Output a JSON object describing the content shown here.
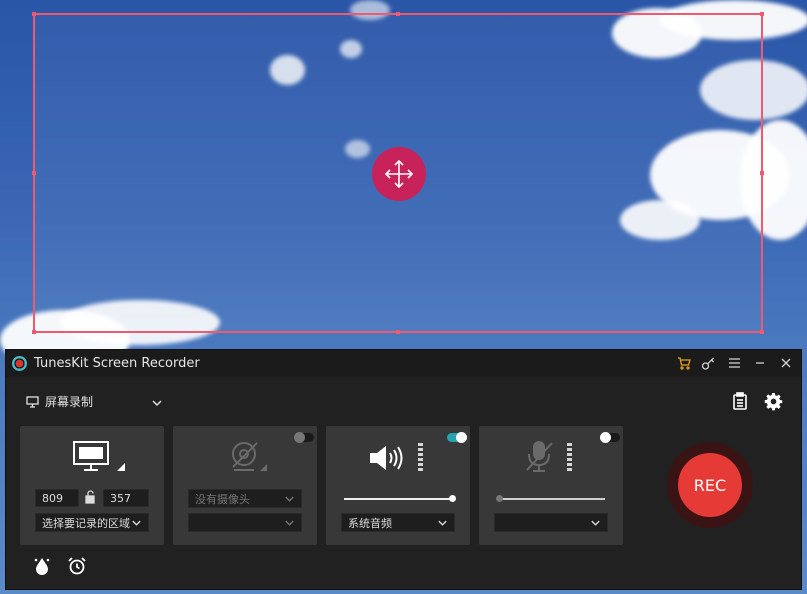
{
  "window": {
    "title": "TunesKit Screen Recorder"
  },
  "mode": {
    "label": "屏幕录制"
  },
  "screen_panel": {
    "width": "809",
    "height": "357",
    "region_select": "选择要记录的区域"
  },
  "camera_panel": {
    "camera_select": "没有摄像头",
    "format_select": ""
  },
  "system_audio_panel": {
    "source_select": "系统音频",
    "volume": 1.0,
    "enabled": true
  },
  "mic_panel": {
    "source_select": "",
    "volume": 0.0,
    "enabled": false
  },
  "record": {
    "label": "REC"
  },
  "colors": {
    "frame": "#f05a6e",
    "move_handle": "#c8225a",
    "rec": "#e53a35",
    "accent": "#25a4b0",
    "cart": "#e8a317"
  },
  "icons": {
    "cart": "cart-icon",
    "key": "key-icon",
    "menu": "menu-icon",
    "minimize": "minimize-icon",
    "close": "close-icon",
    "monitor": "monitor-icon",
    "chevron": "chevron-down-icon",
    "clipboard": "clipboard-icon",
    "settings": "gear-icon",
    "speaker": "speaker-icon",
    "camera_off": "camera-off-icon",
    "mic_off": "mic-off-icon",
    "cursor_effect": "cursor-effect-icon",
    "alarm": "alarm-clock-icon"
  }
}
